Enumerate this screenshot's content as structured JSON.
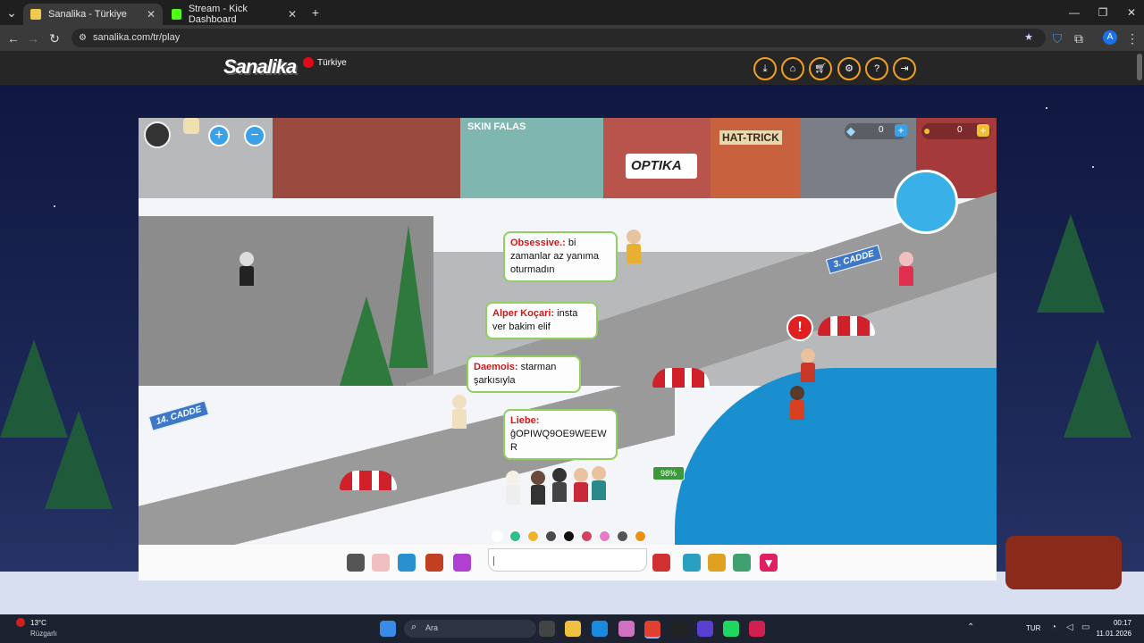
{
  "browser": {
    "tabs": [
      {
        "title": "Sanalika - Türkiye"
      },
      {
        "title": "Stream - Kick Dashboard"
      }
    ],
    "url": "sanalika.com/tr/play",
    "new_tab": "+",
    "profile_initial": "A"
  },
  "site": {
    "logo": "Sanalika",
    "region": "Türkiye",
    "header_icons": [
      "download-icon",
      "home-icon",
      "cart-icon",
      "gear-icon",
      "help-icon",
      "logout-icon"
    ]
  },
  "game": {
    "gems": "0",
    "coins": "0",
    "shops": [
      "SKIN FALAS",
      "OPTIKA",
      "HAT-TRICK"
    ],
    "street_signs": [
      "3. CADDE",
      "14. CADDE"
    ],
    "progress": "98%",
    "progress_value": 0.98,
    "chat": [
      {
        "name": "Obsessive.:",
        "text": "bi zamanlar az yanıma oturmadın"
      },
      {
        "name": "Alper Koçari:",
        "text": "insta ver bakim elif"
      },
      {
        "name": "Daemois:",
        "text": "starman şarkısıyla"
      },
      {
        "name": "Liebe:",
        "text": "ĝOPIWQ9OE9WEEWR"
      }
    ],
    "chat_input_value": "|",
    "emote_colors": [
      "#ffffff",
      "#2fc08a",
      "#f0b428",
      "#4a4a4a",
      "#111111",
      "#d84060",
      "#e878c8",
      "#555555",
      "#f09010"
    ]
  },
  "taskbar": {
    "weather_temp": "13°C",
    "weather_desc": "Rüzgarlı",
    "search_placeholder": "Ara",
    "lang": "TUR",
    "time": "00:17",
    "date": "11.01.2026"
  },
  "colors": {
    "accent": "#f0a020",
    "chat_border": "#8fd060",
    "chat_name": "#d01818",
    "sea": "#1a8fd0"
  }
}
